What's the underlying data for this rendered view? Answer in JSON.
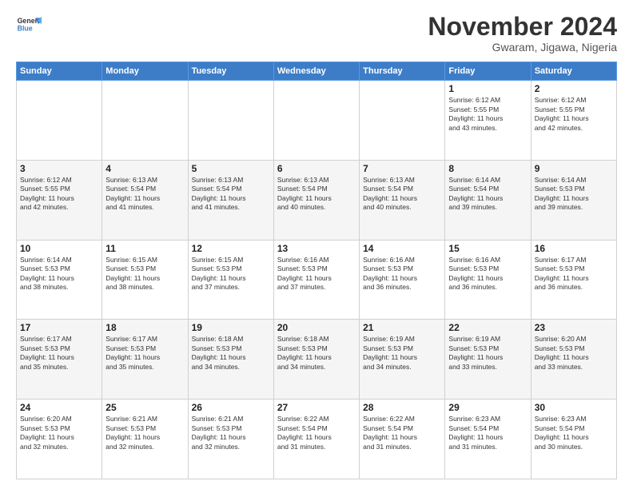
{
  "logo": {
    "line1": "General",
    "line2": "Blue"
  },
  "title": "November 2024",
  "location": "Gwaram, Jigawa, Nigeria",
  "weekdays": [
    "Sunday",
    "Monday",
    "Tuesday",
    "Wednesday",
    "Thursday",
    "Friday",
    "Saturday"
  ],
  "weeks": [
    [
      {
        "day": "",
        "info": ""
      },
      {
        "day": "",
        "info": ""
      },
      {
        "day": "",
        "info": ""
      },
      {
        "day": "",
        "info": ""
      },
      {
        "day": "",
        "info": ""
      },
      {
        "day": "1",
        "info": "Sunrise: 6:12 AM\nSunset: 5:55 PM\nDaylight: 11 hours\nand 43 minutes."
      },
      {
        "day": "2",
        "info": "Sunrise: 6:12 AM\nSunset: 5:55 PM\nDaylight: 11 hours\nand 42 minutes."
      }
    ],
    [
      {
        "day": "3",
        "info": "Sunrise: 6:12 AM\nSunset: 5:55 PM\nDaylight: 11 hours\nand 42 minutes."
      },
      {
        "day": "4",
        "info": "Sunrise: 6:13 AM\nSunset: 5:54 PM\nDaylight: 11 hours\nand 41 minutes."
      },
      {
        "day": "5",
        "info": "Sunrise: 6:13 AM\nSunset: 5:54 PM\nDaylight: 11 hours\nand 41 minutes."
      },
      {
        "day": "6",
        "info": "Sunrise: 6:13 AM\nSunset: 5:54 PM\nDaylight: 11 hours\nand 40 minutes."
      },
      {
        "day": "7",
        "info": "Sunrise: 6:13 AM\nSunset: 5:54 PM\nDaylight: 11 hours\nand 40 minutes."
      },
      {
        "day": "8",
        "info": "Sunrise: 6:14 AM\nSunset: 5:54 PM\nDaylight: 11 hours\nand 39 minutes."
      },
      {
        "day": "9",
        "info": "Sunrise: 6:14 AM\nSunset: 5:53 PM\nDaylight: 11 hours\nand 39 minutes."
      }
    ],
    [
      {
        "day": "10",
        "info": "Sunrise: 6:14 AM\nSunset: 5:53 PM\nDaylight: 11 hours\nand 38 minutes."
      },
      {
        "day": "11",
        "info": "Sunrise: 6:15 AM\nSunset: 5:53 PM\nDaylight: 11 hours\nand 38 minutes."
      },
      {
        "day": "12",
        "info": "Sunrise: 6:15 AM\nSunset: 5:53 PM\nDaylight: 11 hours\nand 37 minutes."
      },
      {
        "day": "13",
        "info": "Sunrise: 6:16 AM\nSunset: 5:53 PM\nDaylight: 11 hours\nand 37 minutes."
      },
      {
        "day": "14",
        "info": "Sunrise: 6:16 AM\nSunset: 5:53 PM\nDaylight: 11 hours\nand 36 minutes."
      },
      {
        "day": "15",
        "info": "Sunrise: 6:16 AM\nSunset: 5:53 PM\nDaylight: 11 hours\nand 36 minutes."
      },
      {
        "day": "16",
        "info": "Sunrise: 6:17 AM\nSunset: 5:53 PM\nDaylight: 11 hours\nand 36 minutes."
      }
    ],
    [
      {
        "day": "17",
        "info": "Sunrise: 6:17 AM\nSunset: 5:53 PM\nDaylight: 11 hours\nand 35 minutes."
      },
      {
        "day": "18",
        "info": "Sunrise: 6:17 AM\nSunset: 5:53 PM\nDaylight: 11 hours\nand 35 minutes."
      },
      {
        "day": "19",
        "info": "Sunrise: 6:18 AM\nSunset: 5:53 PM\nDaylight: 11 hours\nand 34 minutes."
      },
      {
        "day": "20",
        "info": "Sunrise: 6:18 AM\nSunset: 5:53 PM\nDaylight: 11 hours\nand 34 minutes."
      },
      {
        "day": "21",
        "info": "Sunrise: 6:19 AM\nSunset: 5:53 PM\nDaylight: 11 hours\nand 34 minutes."
      },
      {
        "day": "22",
        "info": "Sunrise: 6:19 AM\nSunset: 5:53 PM\nDaylight: 11 hours\nand 33 minutes."
      },
      {
        "day": "23",
        "info": "Sunrise: 6:20 AM\nSunset: 5:53 PM\nDaylight: 11 hours\nand 33 minutes."
      }
    ],
    [
      {
        "day": "24",
        "info": "Sunrise: 6:20 AM\nSunset: 5:53 PM\nDaylight: 11 hours\nand 32 minutes."
      },
      {
        "day": "25",
        "info": "Sunrise: 6:21 AM\nSunset: 5:53 PM\nDaylight: 11 hours\nand 32 minutes."
      },
      {
        "day": "26",
        "info": "Sunrise: 6:21 AM\nSunset: 5:53 PM\nDaylight: 11 hours\nand 32 minutes."
      },
      {
        "day": "27",
        "info": "Sunrise: 6:22 AM\nSunset: 5:54 PM\nDaylight: 11 hours\nand 31 minutes."
      },
      {
        "day": "28",
        "info": "Sunrise: 6:22 AM\nSunset: 5:54 PM\nDaylight: 11 hours\nand 31 minutes."
      },
      {
        "day": "29",
        "info": "Sunrise: 6:23 AM\nSunset: 5:54 PM\nDaylight: 11 hours\nand 31 minutes."
      },
      {
        "day": "30",
        "info": "Sunrise: 6:23 AM\nSunset: 5:54 PM\nDaylight: 11 hours\nand 30 minutes."
      }
    ]
  ]
}
